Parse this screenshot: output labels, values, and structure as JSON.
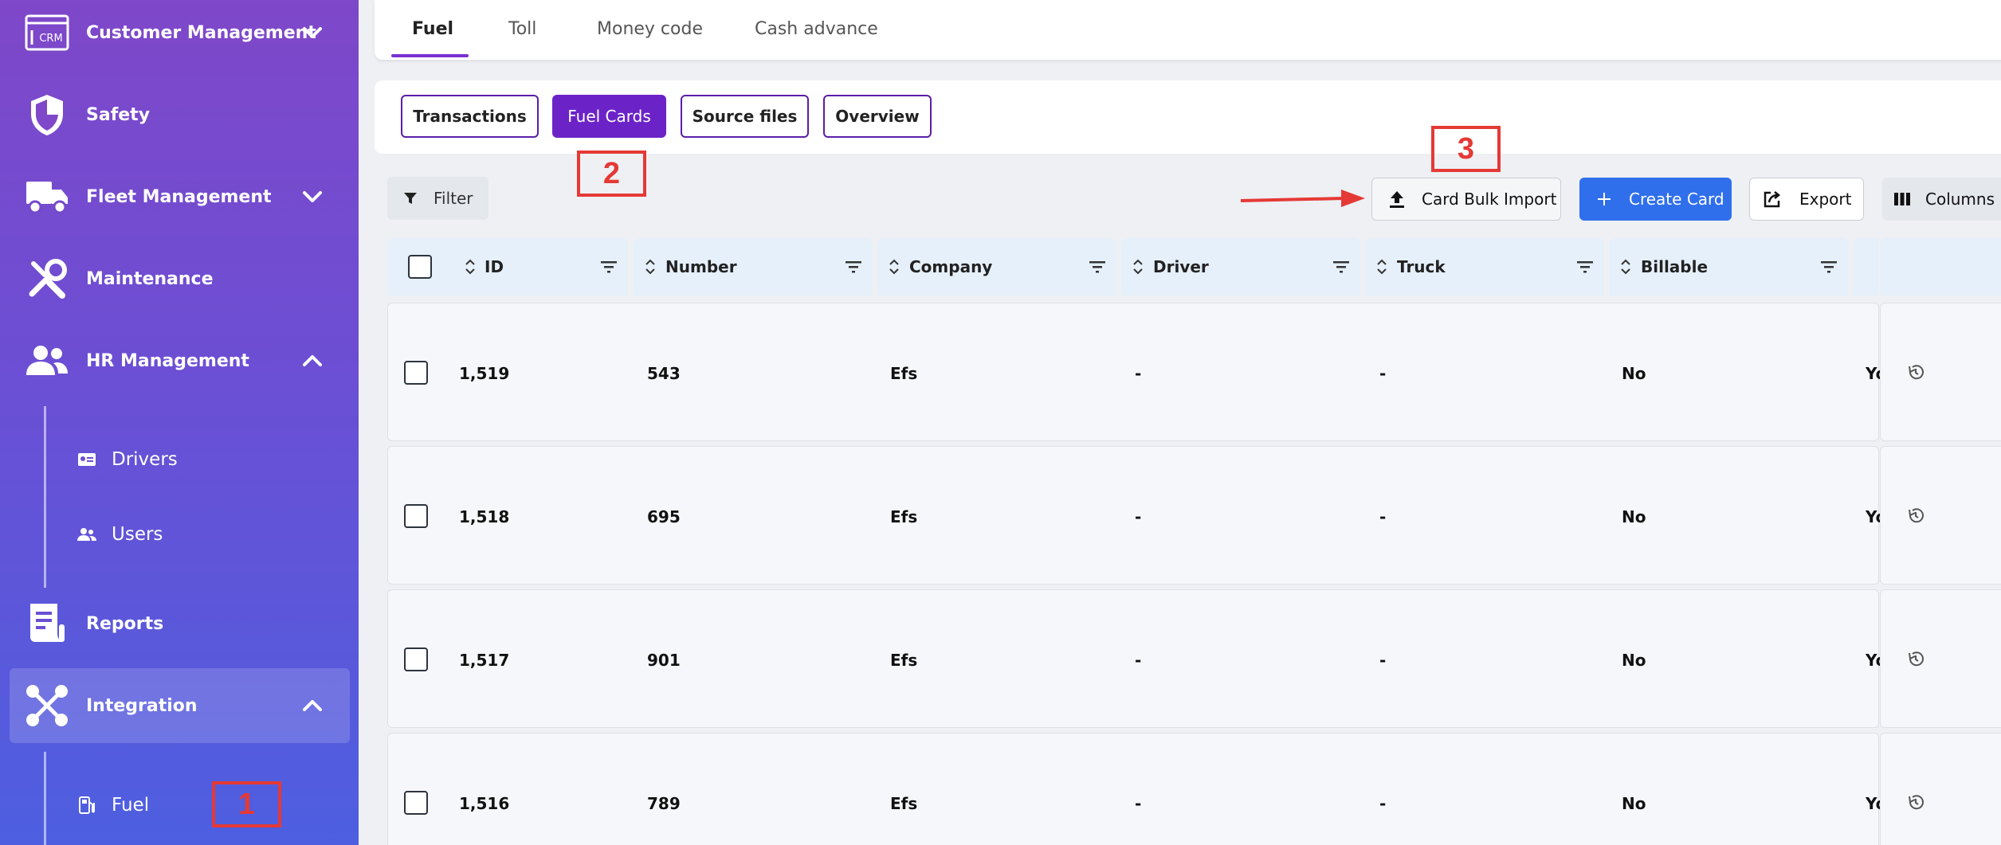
{
  "sidebar": {
    "items": [
      {
        "label": "Customer Management"
      },
      {
        "label": "Safety"
      },
      {
        "label": "Fleet Management"
      },
      {
        "label": "Maintenance"
      },
      {
        "label": "HR Management"
      },
      {
        "label": "Reports"
      },
      {
        "label": "Integration"
      }
    ],
    "crm_icon_text": "CRM",
    "hr_sub": [
      {
        "label": "Drivers"
      },
      {
        "label": "Users"
      }
    ],
    "integration_sub": [
      {
        "label": "Fuel"
      }
    ]
  },
  "annotations": {
    "one": "1",
    "two": "2",
    "three": "3"
  },
  "tabs": [
    {
      "label": "Fuel",
      "active": true
    },
    {
      "label": "Toll"
    },
    {
      "label": "Money code"
    },
    {
      "label": "Cash advance"
    }
  ],
  "subtabs": [
    {
      "label": "Transactions"
    },
    {
      "label": "Fuel Cards",
      "active": true
    },
    {
      "label": "Source files"
    },
    {
      "label": "Overview"
    }
  ],
  "toolbar": {
    "filter": "Filter",
    "bulk_import": "Card Bulk Import",
    "create": "Create Card",
    "export": "Export",
    "columns": "Columns"
  },
  "table": {
    "columns": [
      "ID",
      "Number",
      "Company",
      "Driver",
      "Truck",
      "Billable"
    ],
    "rows": [
      {
        "id": "1,519",
        "number": "543",
        "company": "Efs",
        "driver": "-",
        "truck": "-",
        "billable": "No",
        "extra": "Yo"
      },
      {
        "id": "1,518",
        "number": "695",
        "company": "Efs",
        "driver": "-",
        "truck": "-",
        "billable": "No",
        "extra": "Yo"
      },
      {
        "id": "1,517",
        "number": "901",
        "company": "Efs",
        "driver": "-",
        "truck": "-",
        "billable": "No",
        "extra": "Yo"
      },
      {
        "id": "1,516",
        "number": "789",
        "company": "Efs",
        "driver": "-",
        "truck": "-",
        "billable": "No",
        "extra": "Yo"
      }
    ]
  },
  "colors": {
    "accent": "#6b23c8",
    "primary": "#2f6fec",
    "annotation": "#e53935"
  }
}
